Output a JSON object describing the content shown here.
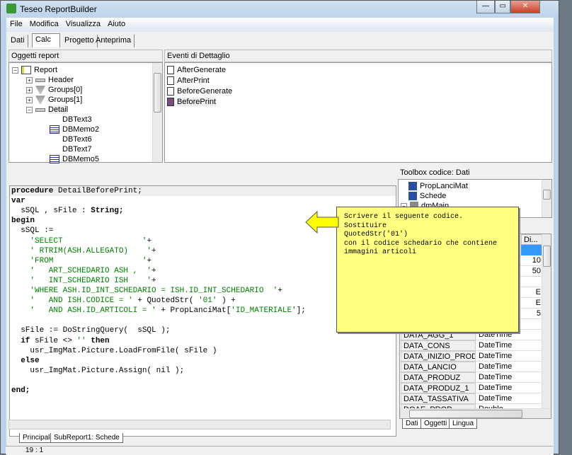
{
  "window": {
    "title": "Teseo ReportBuilder",
    "minimize": "—",
    "maximize": "▭",
    "close": "✕"
  },
  "menu": [
    "File",
    "Modifica",
    "Visualizza",
    "Aiuto"
  ],
  "tabs": [
    "Dati",
    "Calc",
    "Progetto",
    "Anteprima"
  ],
  "objects_panel": {
    "header": "Oggetti report",
    "items": [
      {
        "label": "Report",
        "icon": "report-icon",
        "expander": "−"
      },
      {
        "label": "Header",
        "icon": "band-icon",
        "expander": "+"
      },
      {
        "label": "Groups[0]",
        "icon": "funnel-icon",
        "expander": "+"
      },
      {
        "label": "Groups[1]",
        "icon": "funnel-icon",
        "expander": "+"
      },
      {
        "label": "Detail",
        "icon": "band-icon",
        "expander": "−"
      },
      {
        "label": "DBText3",
        "icon": "dbtext-icon"
      },
      {
        "label": "DBMemo2",
        "icon": "dbmemo-icon"
      },
      {
        "label": "DBText6",
        "icon": "dbtext-icon"
      },
      {
        "label": "DBText7",
        "icon": "dbtext-icon"
      },
      {
        "label": "DBMemo5",
        "icon": "dbmemo-icon"
      }
    ]
  },
  "events_panel": {
    "header": "Eventi di Dettaglio",
    "items": [
      "AfterGenerate",
      "AfterPrint",
      "BeforeGenerate",
      "BeforePrint"
    ],
    "selected": "BeforePrint"
  },
  "code_lines": [
    [
      {
        "t": "procedure",
        "c": "kw"
      },
      {
        "t": " DetailBeforePrint;"
      }
    ],
    [
      {
        "t": "var",
        "c": "kw"
      }
    ],
    [
      {
        "t": "  sSQL , sFile : "
      },
      {
        "t": "String;",
        "c": "kw"
      }
    ],
    [
      {
        "t": "begin",
        "c": "kw"
      }
    ],
    [
      {
        "t": "  sSQL :="
      }
    ],
    [
      {
        "t": "    'SELECT                 '",
        "c": "str"
      },
      {
        "t": "+"
      }
    ],
    [
      {
        "t": "    ' RTRIM(ASH.ALLEGATO)    '",
        "c": "str"
      },
      {
        "t": "+"
      }
    ],
    [
      {
        "t": "    'FROM                   '",
        "c": "str"
      },
      {
        "t": "+"
      }
    ],
    [
      {
        "t": "    '   ART_SCHEDARIO ASH ,  '",
        "c": "str"
      },
      {
        "t": "+"
      }
    ],
    [
      {
        "t": "    '   INT_SCHEDARIO ISH    '",
        "c": "str"
      },
      {
        "t": "+"
      }
    ],
    [
      {
        "t": "    'WHERE ASH.ID_INT_SCHEDARIO = ISH.ID_INT_SCHEDARIO  '",
        "c": "str"
      },
      {
        "t": "+"
      }
    ],
    [
      {
        "t": "    '   AND ISH.CODICE = '",
        "c": "str"
      },
      {
        "t": " + QuotedStr( "
      },
      {
        "t": "'01'",
        "c": "str"
      },
      {
        "t": " ) +"
      }
    ],
    [
      {
        "t": "    '   AND ASH.ID_ARTICOLI = '",
        "c": "str"
      },
      {
        "t": " + PropLanciMat["
      },
      {
        "t": "'ID_MATERIALE'",
        "c": "str"
      },
      {
        "t": "];"
      }
    ],
    [
      {
        "t": ""
      }
    ],
    [
      {
        "t": "  sFile := DoStringQuery(  sSQL );"
      }
    ],
    [
      {
        "t": "  "
      },
      {
        "t": "if",
        "c": "kw"
      },
      {
        "t": " sFile <> "
      },
      {
        "t": "''",
        "c": "str"
      },
      {
        "t": " "
      },
      {
        "t": "then",
        "c": "kw"
      }
    ],
    [
      {
        "t": "    usr_ImgMat.Picture.LoadFromFile( sFile )"
      }
    ],
    [
      {
        "t": "  "
      },
      {
        "t": "else",
        "c": "kw"
      }
    ],
    [
      {
        "t": "    usr_ImgMat.Picture.Assign( nil );"
      }
    ],
    [
      {
        "t": ""
      }
    ],
    [
      {
        "t": "end;",
        "c": "kw"
      }
    ]
  ],
  "note": "Scrivere il seguente codice.\nSostituire\nQuotedStr('01')\ncon il codice schedario che contiene\nimmagini articoli",
  "toolbox": {
    "header": "Toolbox codice: Dati",
    "items": [
      "PropLanciMat",
      "Schede",
      "dmMain"
    ]
  },
  "fields": {
    "col3_header": "Di...",
    "rows": [
      {
        "name": "",
        "type": "",
        "size": ""
      },
      {
        "name": "",
        "type": "",
        "size": "10"
      },
      {
        "name": "",
        "type": "",
        "size": "50"
      },
      {
        "name": "",
        "type": "",
        "size": ""
      },
      {
        "name": "",
        "type": "",
        "size": "E"
      },
      {
        "name": "",
        "type": "",
        "size": "E"
      },
      {
        "name": "",
        "type": "",
        "size": "5"
      },
      {
        "name": "",
        "type": "",
        "size": ""
      },
      {
        "name": "DATA_AGG_1",
        "type": "DateTime",
        "size": ""
      },
      {
        "name": "DATA_CONS",
        "type": "DateTime",
        "size": ""
      },
      {
        "name": "DATA_INIZIO_PRODU",
        "type": "DateTime",
        "size": ""
      },
      {
        "name": "DATA_LANCIO",
        "type": "DateTime",
        "size": ""
      },
      {
        "name": "DATA_PRODUZ",
        "type": "DateTime",
        "size": ""
      },
      {
        "name": "DATA_PRODUZ_1",
        "type": "DateTime",
        "size": ""
      },
      {
        "name": "DATA_TASSATIVA",
        "type": "DateTime",
        "size": ""
      },
      {
        "name": "DOAE_PROD",
        "type": "Double",
        "size": ""
      }
    ]
  },
  "right_tabs": [
    "Dati",
    "Oggetti",
    "Lingua"
  ],
  "bottom_tabs": [
    "Principale",
    "SubReport1: Schede"
  ],
  "status": {
    "position": "19 : 1"
  },
  "colors": {
    "string": "#008000",
    "note": "#ffff80",
    "arrow": "#ffff00",
    "selection": "#3399ff"
  }
}
